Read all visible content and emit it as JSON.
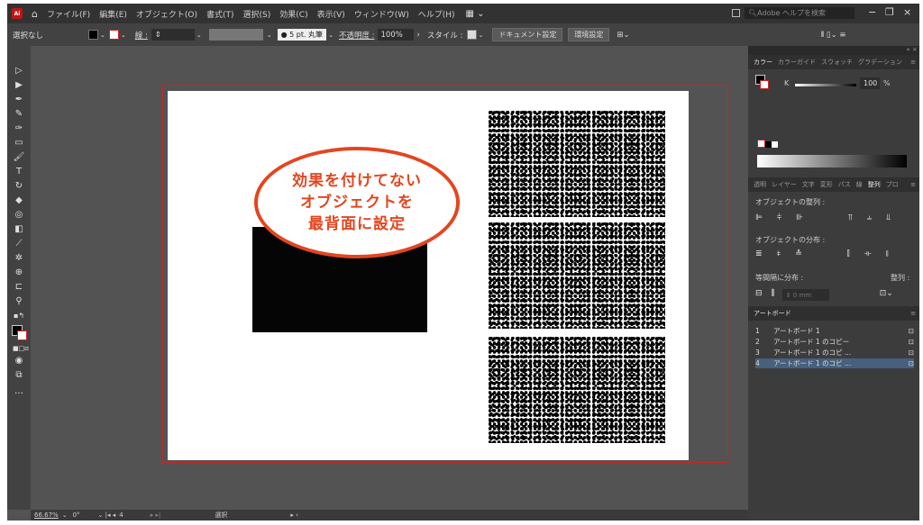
{
  "menubar": {
    "logo": "Ai",
    "items": [
      "ファイル(F)",
      "編集(E)",
      "オブジェクト(O)",
      "書式(T)",
      "選択(S)",
      "効果(C)",
      "表示(V)",
      "ウィンドウ(W)",
      "ヘルプ(H)"
    ],
    "search_placeholder": "Adobe ヘルプを検索",
    "minimize": "−",
    "restore": "❐",
    "close": "×"
  },
  "controlbar": {
    "selection": "選択なし",
    "stroke_label": "線 :",
    "stroke_profile": "5 pt. 丸筆",
    "opacity_label": "不透明度 :",
    "opacity_value": "100%",
    "style_label": "スタイル :",
    "doc_settings": "ドキュメント設定",
    "preferences": "環境設定"
  },
  "callout": {
    "line1": "効果を付けてない",
    "line2": "オブジェクトを",
    "line3": "最背面に設定"
  },
  "color_panel": {
    "tabs": [
      "カラー",
      "カラーガイド",
      "スウォッチ",
      "グラデーション"
    ],
    "channel": "K",
    "value": "100",
    "unit": "%"
  },
  "align_panel": {
    "tabs": [
      "透明",
      "レイヤー",
      "文字",
      "変形",
      "パス",
      "線",
      "整列",
      "プロ"
    ],
    "align_objects": "オブジェクトの整列 :",
    "distribute_objects": "オブジェクトの分布 :",
    "distribute_spacing": "等間隔に分布 :",
    "align_to": "整列 :",
    "spacing_value": "0 mm"
  },
  "artboards_panel": {
    "title": "アートボード",
    "rows": [
      {
        "num": "1",
        "name": "アートボード 1"
      },
      {
        "num": "2",
        "name": "アートボード 1 のコピー"
      },
      {
        "num": "3",
        "name": "アートボード 1 のコピ ..."
      },
      {
        "num": "4",
        "name": "アートボード 1 のコピ ..."
      }
    ]
  },
  "statusbar": {
    "zoom": "66.67%",
    "rotation": "0°",
    "artboard": "4",
    "tool": "選択"
  },
  "colors": {
    "callout_accent": "#e3461f",
    "bleed_guide": "#c22a22",
    "selected_row": "#46607d"
  }
}
